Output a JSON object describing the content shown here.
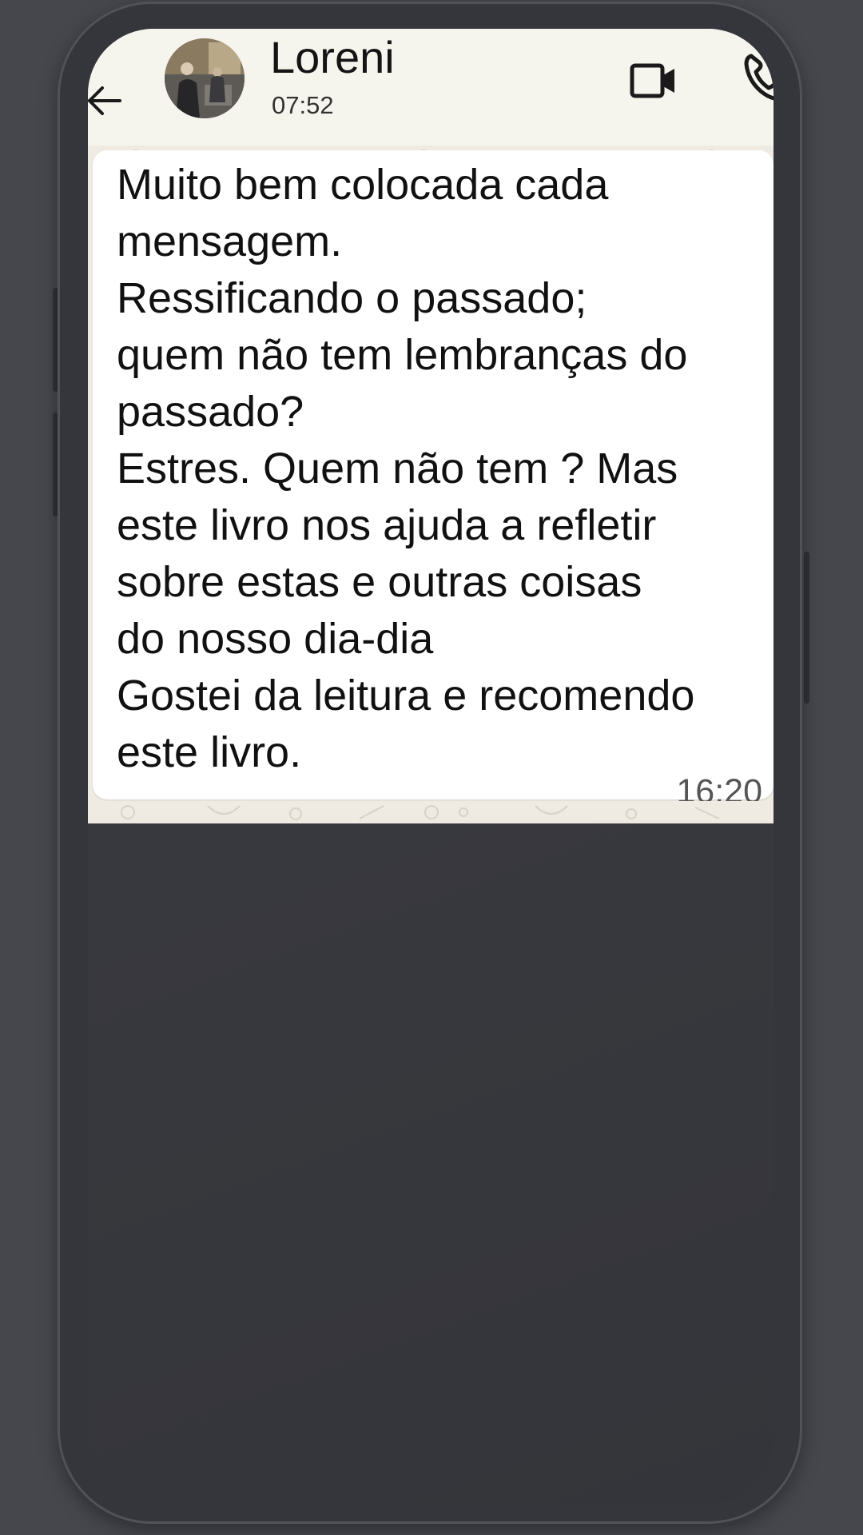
{
  "chat": {
    "contact_name": "Loreni",
    "last_seen": "07:52"
  },
  "message": {
    "text": "Muito bem colocada cada\nmensagem.\nRessificando o passado;\nquem não tem lembranças do\npassado?\nEstres. Quem não tem ? Mas\neste livro nos ajuda a refletir\nsobre estas e outras coisas\ndo nosso dia-dia\nGostei da leitura e recomendo\neste livro.",
    "time": "16:20"
  },
  "icons": {
    "back": "arrow-left-icon",
    "video_call": "video-camera-icon",
    "voice_call": "phone-icon"
  },
  "colors": {
    "page_background": "#45474d",
    "phone_frame": "#34363b",
    "screen_background": "#3a3b40",
    "header_background": "#f6f5ed",
    "chat_wallpaper": "#efeae2",
    "bubble": "#ffffff",
    "message_text": "#111111"
  }
}
